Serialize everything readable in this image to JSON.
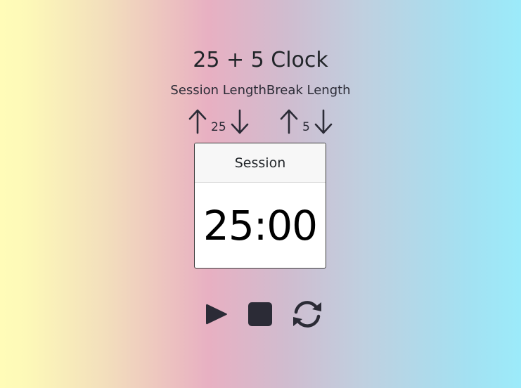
{
  "app": {
    "title": "25 + 5 Clock"
  },
  "labels": {
    "session_length": "Session Length",
    "break_length": "Break Length"
  },
  "session": {
    "value": "25",
    "increment_icon": "arrow-up-icon",
    "decrement_icon": "arrow-down-icon"
  },
  "break": {
    "value": "5",
    "increment_icon": "arrow-up-icon",
    "decrement_icon": "arrow-down-icon"
  },
  "timer": {
    "label": "Session",
    "time": "25:00"
  },
  "controls": {
    "play_icon": "play-icon",
    "stop_icon": "stop-icon",
    "reset_icon": "reset-icon"
  },
  "colors": {
    "icon": "#2b2b36",
    "text": "#212529"
  }
}
